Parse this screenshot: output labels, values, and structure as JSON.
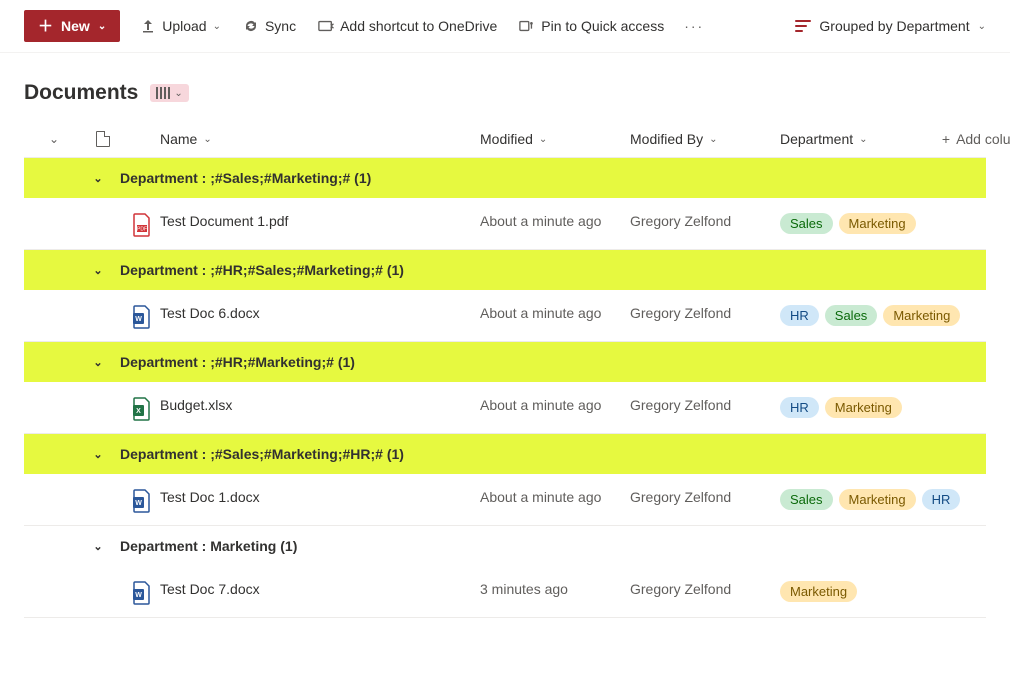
{
  "toolbar": {
    "new_label": "New",
    "upload_label": "Upload",
    "sync_label": "Sync",
    "shortcut_label": "Add shortcut to OneDrive",
    "pin_label": "Pin to Quick access",
    "grouped_label": "Grouped by Department"
  },
  "title": "Documents",
  "columns": {
    "name": "Name",
    "modified": "Modified",
    "modified_by": "Modified By",
    "department": "Department",
    "add_column": "Add column"
  },
  "tag_labels": {
    "sales": "Sales",
    "marketing": "Marketing",
    "hr": "HR"
  },
  "groups": [
    {
      "highlight": true,
      "label": "Department : ;#Sales;#Marketing;# (1)",
      "items": [
        {
          "file_type": "pdf",
          "name": "Test Document 1.pdf",
          "modified": "About a minute ago",
          "modified_by": "Gregory Zelfond",
          "tags": [
            "sales",
            "marketing"
          ]
        }
      ]
    },
    {
      "highlight": true,
      "label": "Department : ;#HR;#Sales;#Marketing;# (1)",
      "items": [
        {
          "file_type": "docx",
          "name": "Test Doc 6.docx",
          "modified": "About a minute ago",
          "modified_by": "Gregory Zelfond",
          "tags": [
            "hr",
            "sales",
            "marketing"
          ]
        }
      ]
    },
    {
      "highlight": true,
      "label": "Department : ;#HR;#Marketing;# (1)",
      "items": [
        {
          "file_type": "xlsx",
          "name": "Budget.xlsx",
          "modified": "About a minute ago",
          "modified_by": "Gregory Zelfond",
          "tags": [
            "hr",
            "marketing"
          ]
        }
      ]
    },
    {
      "highlight": true,
      "label": "Department : ;#Sales;#Marketing;#HR;# (1)",
      "items": [
        {
          "file_type": "docx",
          "name": "Test Doc 1.docx",
          "modified": "About a minute ago",
          "modified_by": "Gregory Zelfond",
          "tags": [
            "sales",
            "marketing",
            "hr"
          ]
        }
      ]
    },
    {
      "highlight": false,
      "label": "Department : Marketing (1)",
      "items": [
        {
          "file_type": "docx",
          "name": "Test Doc 7.docx",
          "modified": "3 minutes ago",
          "modified_by": "Gregory Zelfond",
          "tags": [
            "marketing"
          ]
        }
      ]
    }
  ]
}
